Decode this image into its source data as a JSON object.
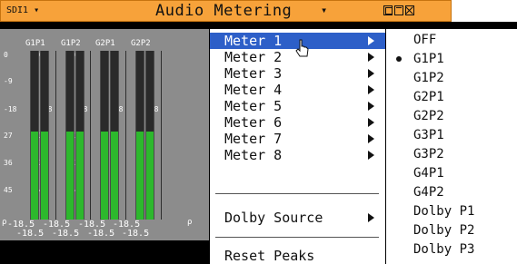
{
  "window": {
    "source_label": "SDI1",
    "source_caret": "▾",
    "title": "Audio Metering",
    "title_caret": "▾"
  },
  "meters": {
    "labels": [
      "G1P1",
      "G1P2",
      "G2P1",
      "G2P2"
    ],
    "scale": [
      "0",
      "-9",
      "-18",
      "27",
      "36",
      "45"
    ],
    "levels_db": [
      -18.5,
      -18.5,
      -18.5,
      -18.5
    ],
    "fill_fraction": 0.52,
    "readouts_top": [
      "-18.5",
      "-18.5",
      "-18.5",
      "-18.5"
    ],
    "readouts_bottom": [
      "-18.5",
      "-18.5",
      "-18.5",
      "-18.5"
    ],
    "peak_marker": "ρ"
  },
  "menu": {
    "items": [
      {
        "label": "Meter 1",
        "selected": true
      },
      {
        "label": "Meter 2"
      },
      {
        "label": "Meter 3"
      },
      {
        "label": "Meter 4"
      },
      {
        "label": "Meter 5"
      },
      {
        "label": "Meter 6"
      },
      {
        "label": "Meter 7"
      },
      {
        "label": "Meter 8"
      }
    ],
    "dolby_source": "Dolby Source",
    "reset_peaks": "Reset Peaks"
  },
  "submenu": {
    "items": [
      "OFF",
      "G1P1",
      "G1P2",
      "G2P1",
      "G2P2",
      "G3P1",
      "G3P2",
      "G4P1",
      "G4P2",
      "Dolby P1",
      "Dolby P2",
      "Dolby P3"
    ],
    "checked": "G1P1"
  },
  "colors": {
    "titlebar": "#f7a23a",
    "meter_fill": "#2db82d",
    "highlight": "#2d5fc8"
  }
}
